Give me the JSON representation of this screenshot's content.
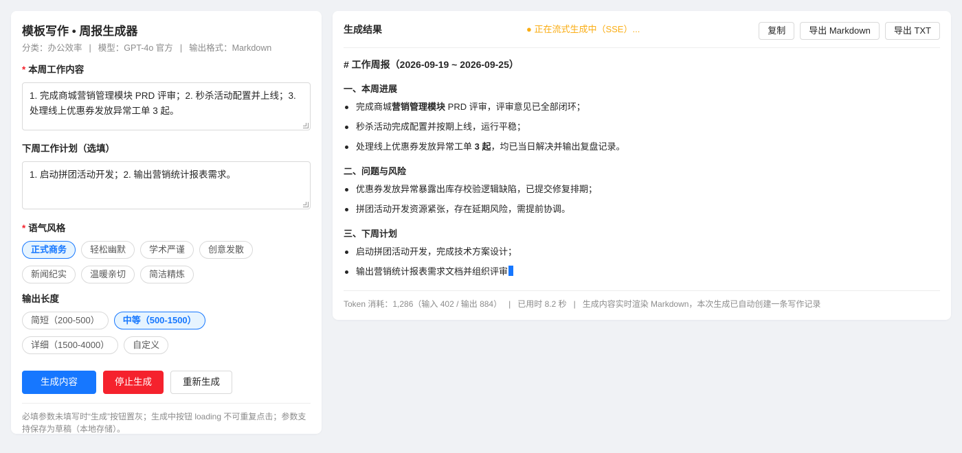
{
  "left": {
    "title": "模板写作 • 周报生成器",
    "meta": {
      "category": "分类：办公效率",
      "model": "模型：GPT-4o 官方",
      "format": "输出格式：Markdown",
      "separator": "|"
    },
    "weekly": {
      "required_mark": "*",
      "label": "本周工作内容",
      "value": "1. 完成商城营销管理模块 PRD 评审；2. 秒杀活动配置并上线；3. 处理线上优惠券发放异常工单 3 起。"
    },
    "next": {
      "label": "下周工作计划（选填）",
      "value": "1. 启动拼团活动开发；2. 输出营销统计报表需求。"
    },
    "tone": {
      "required_mark": "*",
      "label": "语气风格",
      "options": [
        "正式商务",
        "轻松幽默",
        "学术严谨",
        "创意发散",
        "新闻纪实",
        "温暖亲切",
        "简洁精炼"
      ],
      "selected": "正式商务"
    },
    "length": {
      "label": "输出长度",
      "options": [
        "简短（200-500）",
        "中等（500-1500）",
        "详细（1500-4000）",
        "自定义"
      ],
      "selected": "中等（500-1500）"
    },
    "buttons": {
      "generate": "生成内容",
      "stop": "停止生成",
      "regenerate": "重新生成"
    },
    "hint": "必填参数未填写时“生成”按钮置灰；生成中按钮 loading 不可重复点击；参数支持保存为草稿（本地存储）。"
  },
  "right": {
    "title": "生成结果",
    "status": "● 正在流式生成中（SSE）...",
    "actions": {
      "copy": "复制",
      "export_md": "导出 Markdown",
      "export_txt": "导出 TXT"
    },
    "doc": {
      "h1": "# 工作周报（2026-09-19 ~ 2026-09-25）",
      "sections": [
        {
          "heading": "一、本周进展",
          "items": [
            {
              "pre": "完成商城",
              "bold": "营销管理模块",
              "post": " PRD 评审，评审意见已全部闭环；"
            },
            {
              "pre": "秒杀活动完成配置并按期上线，运行平稳；",
              "bold": "",
              "post": ""
            },
            {
              "pre": "处理线上优惠券发放异常工单 ",
              "bold": "3 起",
              "post": "，均已当日解决并输出复盘记录。"
            }
          ]
        },
        {
          "heading": "二、问题与风险",
          "items": [
            {
              "pre": "优惠券发放异常暴露出库存校验逻辑缺陷，已提交修复排期；",
              "bold": "",
              "post": ""
            },
            {
              "pre": "拼团活动开发资源紧张，存在延期风险，需提前协调。",
              "bold": "",
              "post": ""
            }
          ]
        },
        {
          "heading": "三、下周计划",
          "items": [
            {
              "pre": "启动拼团活动开发，完成技术方案设计；",
              "bold": "",
              "post": ""
            },
            {
              "pre": "输出营销统计报表需求文档并组织评审",
              "bold": "",
              "post": ""
            }
          ]
        }
      ]
    },
    "footer": {
      "tokens": "Token 消耗：1,286（输入 402 / 输出 884）",
      "elapsed": "已用时 8.2 秒",
      "note": "生成内容实时渲染 Markdown，本次生成已自动创建一条写作记录",
      "separator": "|"
    }
  },
  "colors": {
    "primary": "#1677ff",
    "danger": "#f5222d",
    "status": "#faad14",
    "background": "#f0f2f5"
  }
}
